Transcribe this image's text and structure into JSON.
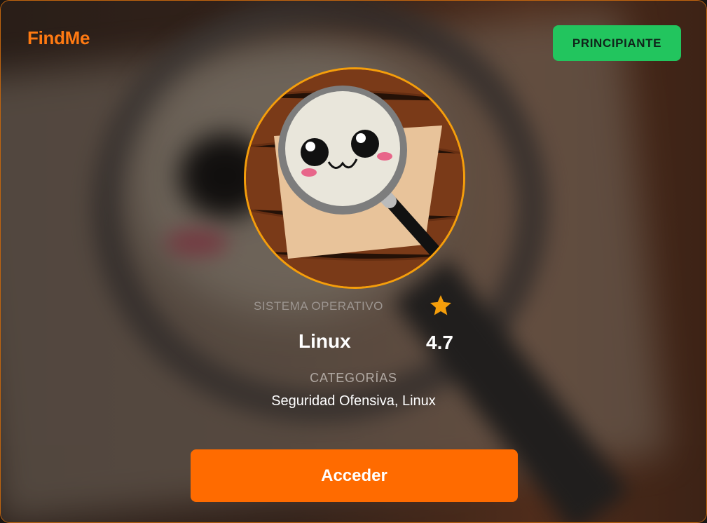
{
  "header": {
    "brand": "FindMe",
    "level_label": "PRINCIPIANTE"
  },
  "machine": {
    "os_label": "SISTEMA OPERATIVO",
    "os_value": "Linux",
    "rating": "4.7",
    "categories_label": "CATEGORÍAS",
    "categories_value": "Seguridad Ofensiva, Linux",
    "image_icon": "magnifying-glass-kawaii-face"
  },
  "actions": {
    "access_label": "Acceder"
  },
  "colors": {
    "brand": "#ff7a12",
    "level_badge": "#22c55e",
    "avatar_border": "#f59e0b",
    "star": "#f59e0b",
    "access_button": "#ff6b00"
  }
}
